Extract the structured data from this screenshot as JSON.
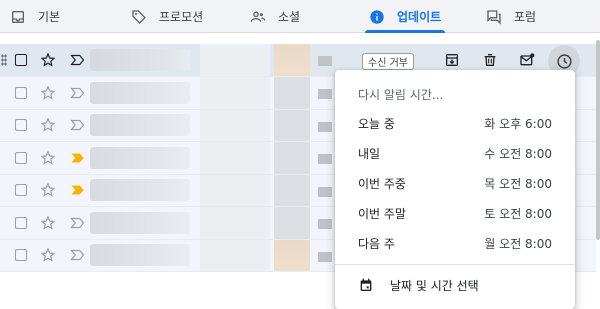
{
  "tabs": [
    {
      "label": "기본",
      "icon": "inbox-icon"
    },
    {
      "label": "프로모션",
      "icon": "tag-icon"
    },
    {
      "label": "소셜",
      "icon": "people-icon"
    },
    {
      "label": "업데이트",
      "icon": "info-icon",
      "active": true
    },
    {
      "label": "포럼",
      "icon": "forum-icon"
    }
  ],
  "first_row": {
    "refuse_label": "수신 거부",
    "actions": [
      "archive-icon",
      "delete-icon",
      "mark-unread-icon",
      "snooze-icon"
    ]
  },
  "rows": [
    {
      "important": false
    },
    {
      "important": false
    },
    {
      "important": true
    },
    {
      "important": true
    },
    {
      "important": false
    },
    {
      "important": false
    }
  ],
  "snooze_menu": {
    "title": "다시 알림 시간...",
    "options": [
      {
        "label": "오늘 중",
        "time": "화 오후 6:00"
      },
      {
        "label": "내일",
        "time": "수 오전 8:00"
      },
      {
        "label": "이번 주중",
        "time": "목 오전 8:00"
      },
      {
        "label": "이번 주말",
        "time": "토 오전 8:00"
      },
      {
        "label": "다음 주",
        "time": "월 오전 8:00"
      }
    ],
    "pick_label": "날짜 및 시간 선택"
  },
  "colors": {
    "accent": "#1a73e8",
    "important_marker": "#f4b400"
  }
}
